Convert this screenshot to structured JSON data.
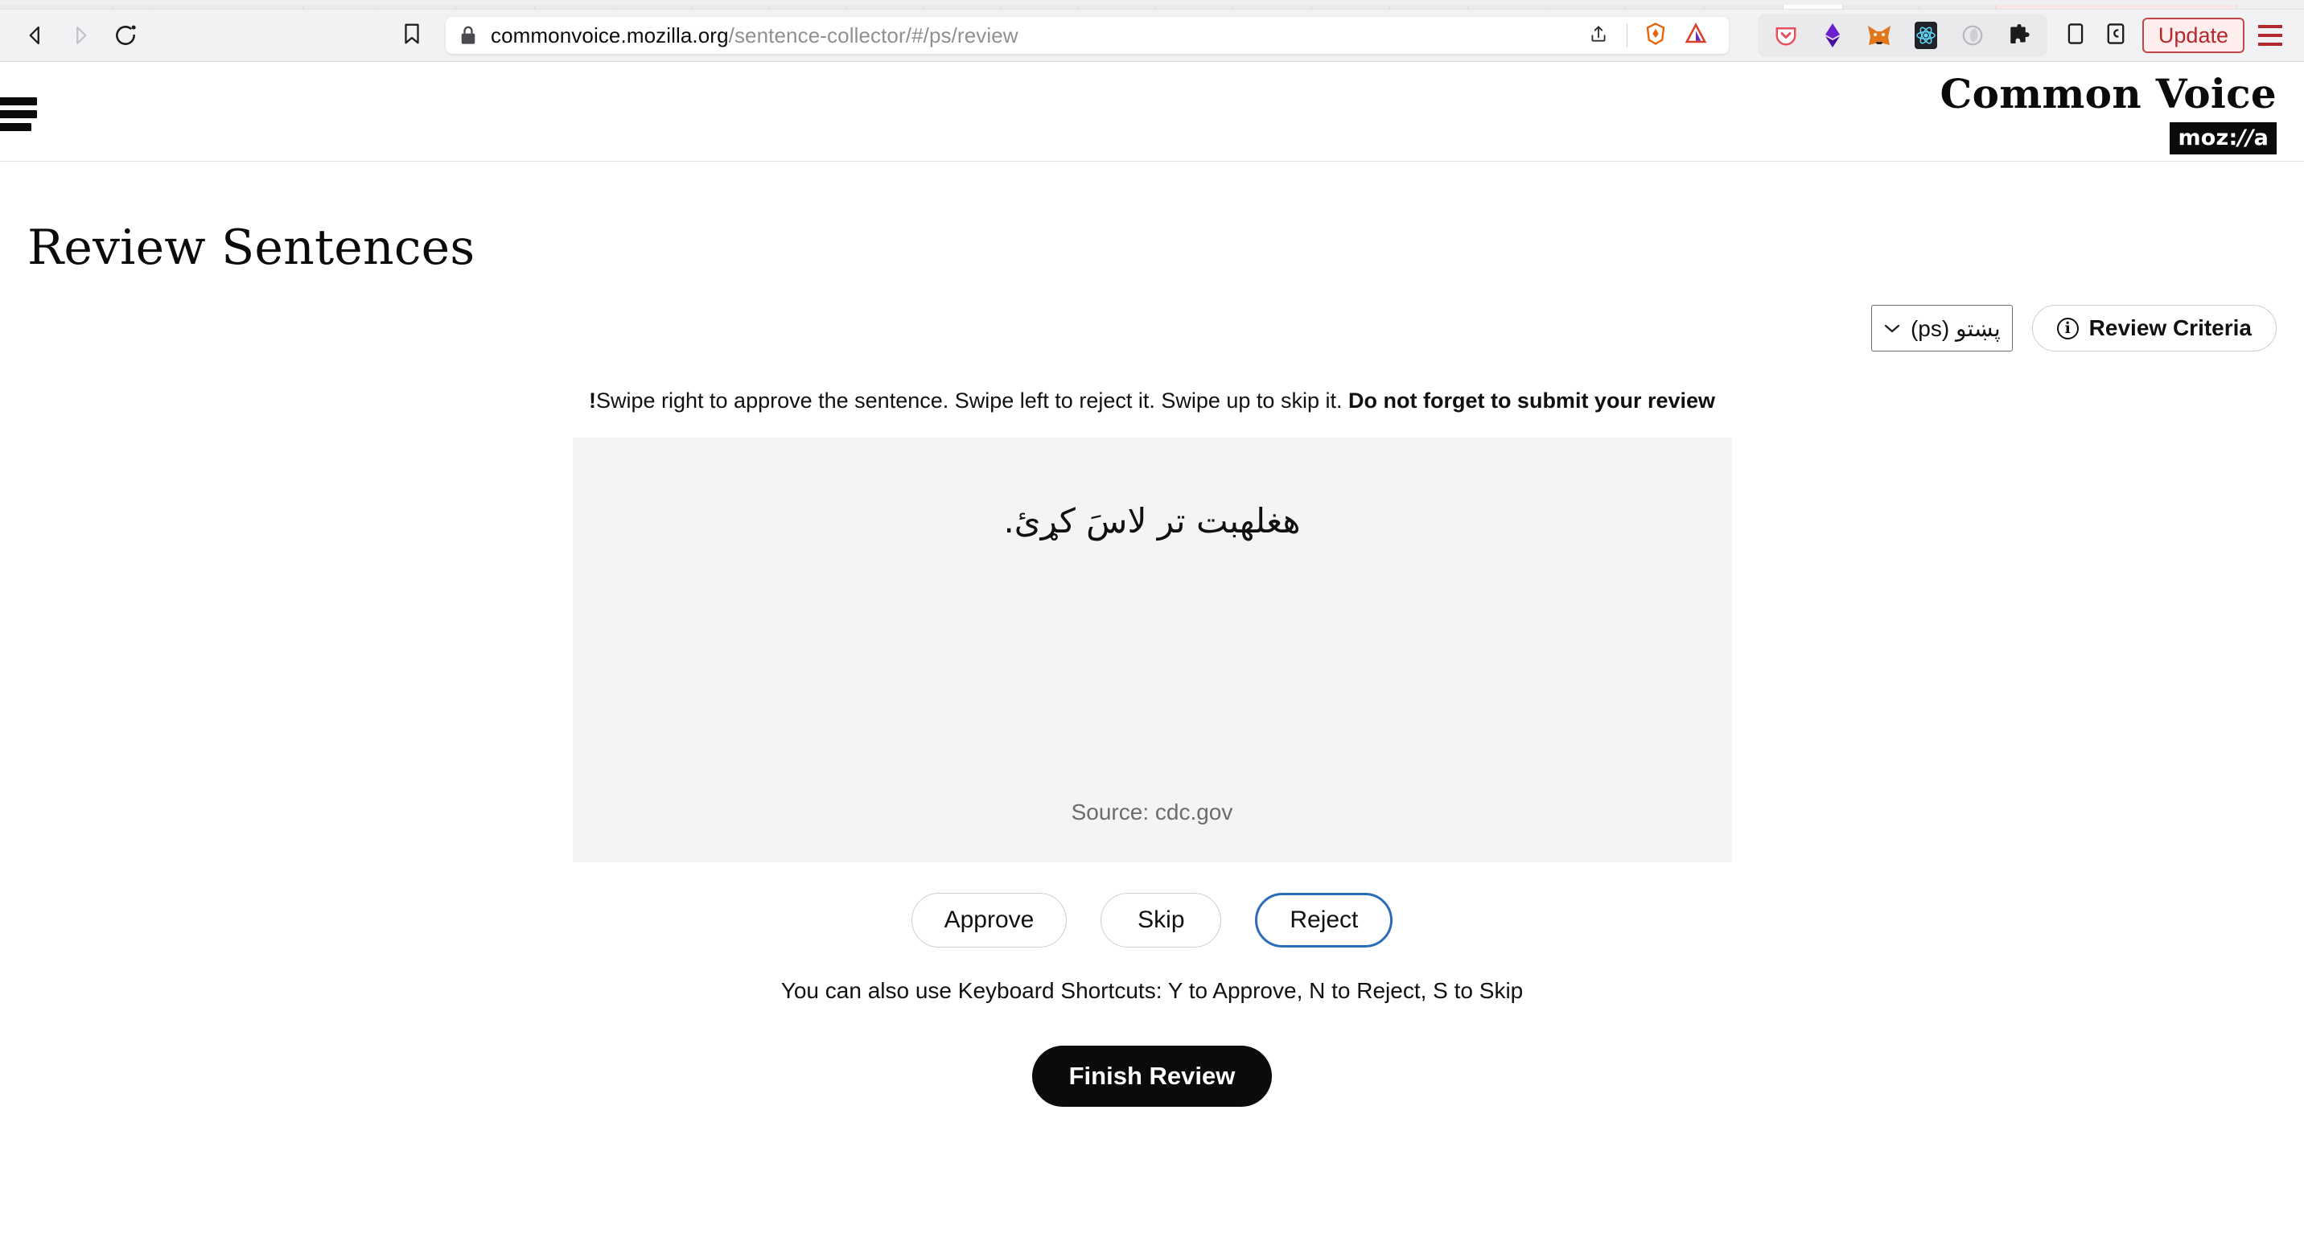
{
  "browser": {
    "nav": {
      "back_icon": "back-arrow-icon",
      "forward_icon": "forward-arrow-icon",
      "reload_icon": "reload-icon",
      "bookmark_icon": "bookmark-icon"
    },
    "urlbar": {
      "lock_icon": "padlock-icon",
      "url_domain": "commonvoice.mozilla.org",
      "url_path": "/sentence-collector/#/ps/review",
      "share_icon": "share-icon",
      "brave_icon": "brave-lion-icon",
      "shields_icon": "brave-triangle-icon"
    },
    "extensions": [
      {
        "name": "pocket-icon",
        "color": "#e8505b"
      },
      {
        "name": "ethereum-wallet-icon",
        "color": "#6a1fd0"
      },
      {
        "name": "metamask-fox-icon",
        "color": "#e2761b"
      },
      {
        "name": "react-devtools-icon",
        "color": "#20232a"
      },
      {
        "name": "moon-extension-icon",
        "color": "#b8b8bd"
      },
      {
        "name": "puzzle-extensions-icon",
        "color": "#1b1b1d"
      }
    ],
    "toolbar_tail": [
      {
        "name": "sidebar-toggle-icon"
      },
      {
        "name": "reader-view-icon"
      }
    ],
    "update_label": "Update",
    "appmenu_icon": "hamburger-menu-icon"
  },
  "site": {
    "menu_icon": "hamburger-menu-icon",
    "brand_title": "Common Voice",
    "brand_moz_pre": "moz:",
    "brand_moz_slashes": "//",
    "brand_moz_post": "a"
  },
  "page": {
    "title": "Review Sentences",
    "criteria_button": "Review Criteria",
    "criteria_info_icon": "info-circle-icon",
    "language_value": "پښتو (ps)",
    "language_chevron_icon": "chevron-down-icon",
    "instructions_main": "Swipe right to approve the sentence. Swipe left to reject it. Swipe up to skip it.",
    "instructions_strong": "Do not forget to submit your review!",
    "sentence_text": "هغلهبت تر لاسَ کړئ.",
    "sentence_source": "Source: cdc.gov",
    "buttons": {
      "approve": "Approve",
      "skip": "Skip",
      "reject": "Reject"
    },
    "shortcuts": "You can also use Keyboard Shortcuts: Y to Approve, N to Reject, S to Skip",
    "finish_button": "Finish Review"
  },
  "colors": {
    "accent_focus": "#2b6cb8",
    "update_border": "#c0484c",
    "update_text": "#b4292e",
    "card_bg": "#f4f4f4",
    "brand_black": "#0b0b0b"
  }
}
